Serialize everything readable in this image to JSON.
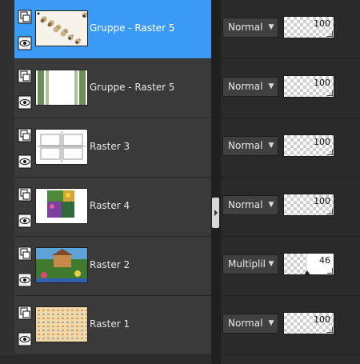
{
  "layers": [
    {
      "name": "Gruppe - Raster 5",
      "selected": true,
      "blend": "Normal",
      "opacity": 100,
      "thumb": "dots"
    },
    {
      "name": "Gruppe - Raster 5",
      "selected": false,
      "blend": "Normal",
      "opacity": 100,
      "thumb": "columns"
    },
    {
      "name": "Raster 3",
      "selected": false,
      "blend": "Normal",
      "opacity": 100,
      "thumb": "frames"
    },
    {
      "name": "Raster 4",
      "selected": false,
      "blend": "Normal",
      "opacity": 100,
      "thumb": "flowers"
    },
    {
      "name": "Raster 2",
      "selected": false,
      "blend": "Multiplikatic",
      "opacity": 46,
      "thumb": "landscape"
    },
    {
      "name": "Raster 1",
      "selected": false,
      "blend": "Normal",
      "opacity": 100,
      "thumb": "pattern"
    }
  ],
  "icons": {
    "layer_type": "layers-icon",
    "visibility": "eye-icon",
    "dropdown": "chevron-down-icon"
  },
  "colors": {
    "selected": "#3a9af5",
    "row": "#3a3a3a",
    "panel": "#2a2a2a"
  }
}
